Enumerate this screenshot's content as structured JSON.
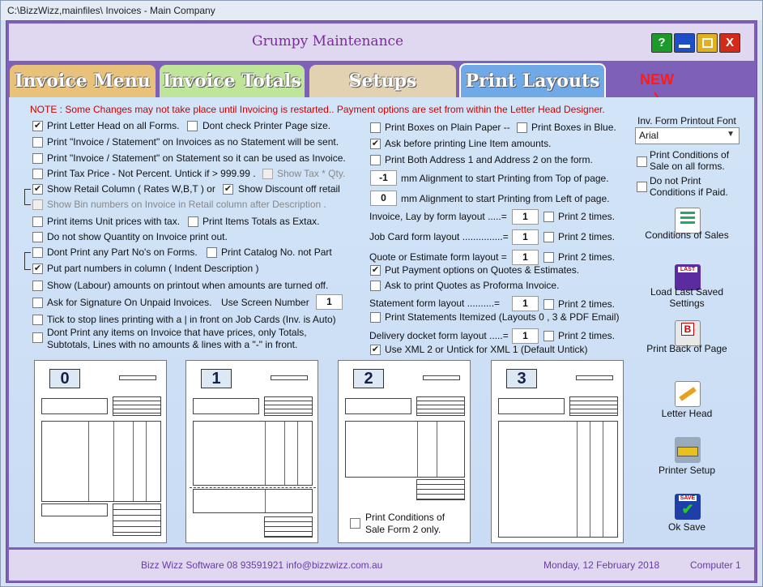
{
  "window_title": "C:\\BizzWizz,mainfiles\\ Invoices - Main Company",
  "header": {
    "title": "Grumpy Maintenance",
    "help": "?",
    "min": "",
    "max": "",
    "close": "X"
  },
  "tabs": [
    "Invoice Menu",
    "Invoice Totals",
    "Setups",
    "Print Layouts"
  ],
  "new_label": "NEW",
  "note": "NOTE : Some Changes may not take place until Invoicing is restarted..  Payment options are set from within the Letter Head Designer.",
  "left": {
    "print_letter_head": "Print Letter Head on all Forms.",
    "dont_check_page": "Dont check Printer Page size.",
    "invoice_no_statement": "Print \"Invoice / Statement\" on Invoices as no Statement will be sent.",
    "invoice_on_statement": "Print \"Invoice / Statement\" on Statement so it can be used as Invoice.",
    "tax_price": "Print Tax Price - Not Percent. Untick if > 999.99 .",
    "show_tax_qty": "Show Tax * Qty.",
    "show_retail": "Show Retail Column ( Rates W,B,T ) or",
    "show_discount": "Show Discount off retail",
    "show_bin": "Show Bin numbers on Invoice in Retail column after Description .",
    "unit_prices": "Print items Unit prices with tax.",
    "totals_extax": "Print Items Totals as Extax.",
    "no_qty": "Do not show Quantity on Invoice print out.",
    "dont_print_part": "Dont Print any Part No's on Forms.",
    "catalog_no": "Print Catalog No. not Part",
    "part_column": "Put part numbers in column ( Indent Description )",
    "show_labour": "Show (Labour) amounts on printout  when amounts are turned off.",
    "signature": "Ask for Signature On Unpaid Invoices.",
    "screen_number_label": "Use Screen Number",
    "screen_number": "1",
    "tick_stop": "Tick to stop lines printing with a  |  in front on Job Cards (Inv. is Auto)",
    "dont_print_line1": "Dont Print any items on Invoice that have prices, only Totals,",
    "dont_print_line2": "Subtotals,  Lines with no amounts & lines with a \"-\" in front."
  },
  "middle": {
    "boxes_plain": "Print Boxes on Plain Paper --",
    "boxes_blue": "Print Boxes in Blue.",
    "ask_line_item": "Ask before printing Line Item amounts.",
    "both_address": "Print Both Address 1 and Address 2 on the form.",
    "top_value": "-1",
    "top_label": "mm  Alignment to start Printing from Top of page.",
    "left_value": "0",
    "left_label": "mm  Alignment to start Printing from Left of page.",
    "invoice_layout": "Invoice, Lay by form layout .....=",
    "invoice_layout_value": "1",
    "job_layout": "Job Card form layout ...............=",
    "job_layout_value": "1",
    "quote_layout": "Quote or Estimate form layout =",
    "quote_layout_value": "1",
    "print2": "Print 2 times.",
    "payment_quotes": "Put Payment options on Quotes & Estimates.",
    "proforma": "Ask to print Quotes as Proforma Invoice.",
    "statement_layout": "Statement form layout ..........=",
    "statement_layout_value": "1",
    "statements_itemized": "Print Statements Itemized (Layouts 0 , 3 & PDF Email)",
    "delivery_layout": "Delivery docket form layout .....=",
    "delivery_layout_value": "1",
    "use_xml": "Use XML 2 or Untick for XML 1  (Default Untick)"
  },
  "right": {
    "font_label": "Inv. Form Printout Font",
    "font_value": "Arial",
    "conditions_all_1": "Print Conditions of",
    "conditions_all_2": "Sale on all forms.",
    "no_print_paid_1": "Do not Print",
    "no_print_paid_2": "Conditions if Paid.",
    "btn_conditions": "Conditions of Sales",
    "btn_load_last": "Load Last Saved Settings",
    "btn_print_back": "Print Back of Page",
    "btn_letter_head": "Letter Head",
    "btn_printer_setup": "Printer Setup",
    "btn_ok_save": "Ok Save",
    "last_icon_text": "LAST",
    "save_icon_text": "SAVE"
  },
  "layouts": {
    "cards": [
      "0",
      "1",
      "2",
      "3"
    ],
    "cond_form2_1": "Print Conditions of",
    "cond_form2_2": "Sale Form 2 only."
  },
  "status": {
    "company": "Bizz Wizz Software  08 93591921   info@bizzwizz.com.au",
    "date": "Monday, 12 February 2018",
    "computer": "Computer 1"
  },
  "colors": {
    "frame": "#7e60b8",
    "panel": "#cfe0f5",
    "note": "#cc0000",
    "tab1": "#e8c27a",
    "tab2": "#bfe59a",
    "tab3": "#e2d2b2",
    "tab4": "#6fa9e8"
  }
}
